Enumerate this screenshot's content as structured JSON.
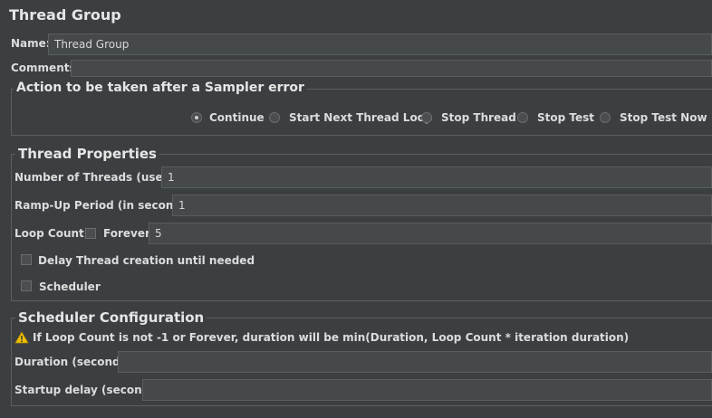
{
  "title": "Thread Group",
  "name": {
    "label": "Name:",
    "value": "Thread Group"
  },
  "comments": {
    "label": "Comments:",
    "value": ""
  },
  "sampler_error": {
    "legend": "Action to be taken after a Sampler error",
    "options": [
      {
        "label": "Continue",
        "selected": true
      },
      {
        "label": "Start Next Thread Loop",
        "selected": false
      },
      {
        "label": "Stop Thread",
        "selected": false
      },
      {
        "label": "Stop Test",
        "selected": false
      },
      {
        "label": "Stop Test Now",
        "selected": false
      }
    ]
  },
  "thread_properties": {
    "legend": "Thread Properties",
    "num_threads": {
      "label": "Number of Threads (users):",
      "value": "1"
    },
    "ramp_up": {
      "label": "Ramp-Up Period (in seconds):",
      "value": "1"
    },
    "loop_count": {
      "label": "Loop Count:",
      "forever_label": "Forever",
      "forever_checked": false,
      "value": "5"
    },
    "delay_thread": {
      "label": "Delay Thread creation until needed",
      "checked": false
    },
    "scheduler": {
      "label": "Scheduler",
      "checked": false
    }
  },
  "scheduler_config": {
    "legend": "Scheduler Configuration",
    "warning_icon": "warning-triangle-icon",
    "warning": "If Loop Count is not -1 or Forever, duration will be min(Duration, Loop Count * iteration duration)",
    "duration": {
      "label": "Duration (seconds)",
      "value": ""
    },
    "startup_delay": {
      "label": "Startup delay (seconds)",
      "value": ""
    }
  }
}
